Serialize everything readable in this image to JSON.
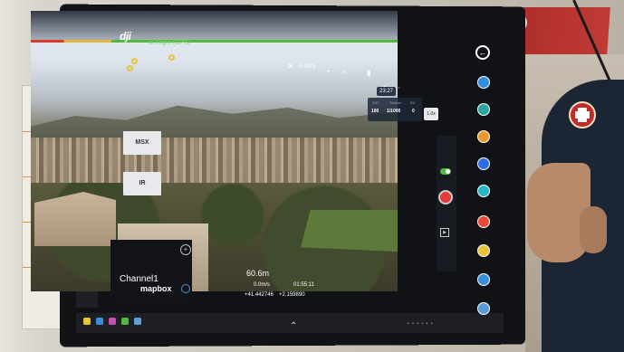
{
  "app": {
    "logo": "dji",
    "flight_status": "In Flight (GPS)",
    "mode": "P-GPS",
    "time": "23:27"
  },
  "camera": {
    "headers": [
      "ISO",
      "Shutter",
      "EV"
    ],
    "values": [
      "100",
      "1/1000",
      "0"
    ],
    "zoom": "1.0x"
  },
  "side_buttons": {
    "msx": "MSX",
    "ir": "IR"
  },
  "map": {
    "channel": "Channel1",
    "provider": "mapbox"
  },
  "telemetry": {
    "altitude": "60.6m",
    "speed": "0.0m/s",
    "flight_time": "01:55:11",
    "latitude": "+41.442746",
    "longitude": "+2.159890"
  },
  "colors": {
    "status_green": "#4fba3c",
    "status_yellow": "#e1b63b",
    "status_red": "#d93a2a",
    "record_red": "#e83a3a"
  },
  "icons": {
    "back": "arrow-left-icon",
    "record": "record-icon",
    "play": "play-icon",
    "taskbar_up": "chevron-up-icon"
  }
}
